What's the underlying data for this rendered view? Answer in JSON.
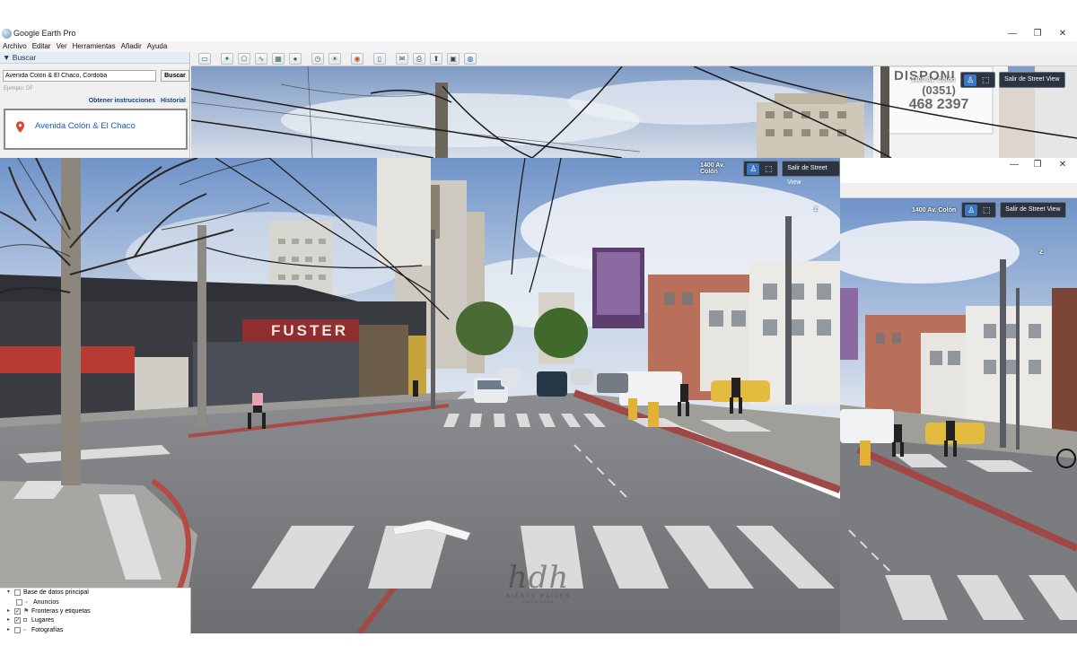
{
  "window": {
    "title": "Google Earth Pro",
    "controls": {
      "minimize": "—",
      "maximize": "❐",
      "close": "✕"
    }
  },
  "menu": {
    "items": [
      "Archivo",
      "Editar",
      "Ver",
      "Herramientas",
      "Añadir",
      "Ayuda"
    ]
  },
  "search": {
    "header": "▼ Buscar",
    "query": "Avenida Colón & El Chaco, Córdoba",
    "button": "Buscar",
    "hint": "Ejemplo: DF",
    "link_directions": "Obtener instrucciones",
    "link_history": "Historial",
    "result": "Avenida Colón & El Chaco"
  },
  "layers": {
    "items": [
      {
        "label": "Base de datos principal",
        "checked": false
      },
      {
        "label": "Anuncios",
        "checked": false
      },
      {
        "label": "Fronteras y etiquetas",
        "checked": true
      },
      {
        "label": "Lugares",
        "checked": true
      },
      {
        "label": "Fotografías",
        "checked": false
      }
    ]
  },
  "streetview": {
    "address": "1400 Av. Colón",
    "exit_label": "Salir de Street View",
    "top_billboard": "DISPONI",
    "top_billboard_phone1": "(0351)",
    "top_billboard_phone2": "468 2397",
    "shop_sign": "FUSTER"
  },
  "watermark": {
    "logo": "hdh",
    "line1": "BIENES RAÍCES",
    "line2": "LUCIA DANA"
  },
  "colors": {
    "accent": "#1f58b8",
    "sv_chrome": "#2c3440",
    "sv_person": "#3d77c4"
  }
}
